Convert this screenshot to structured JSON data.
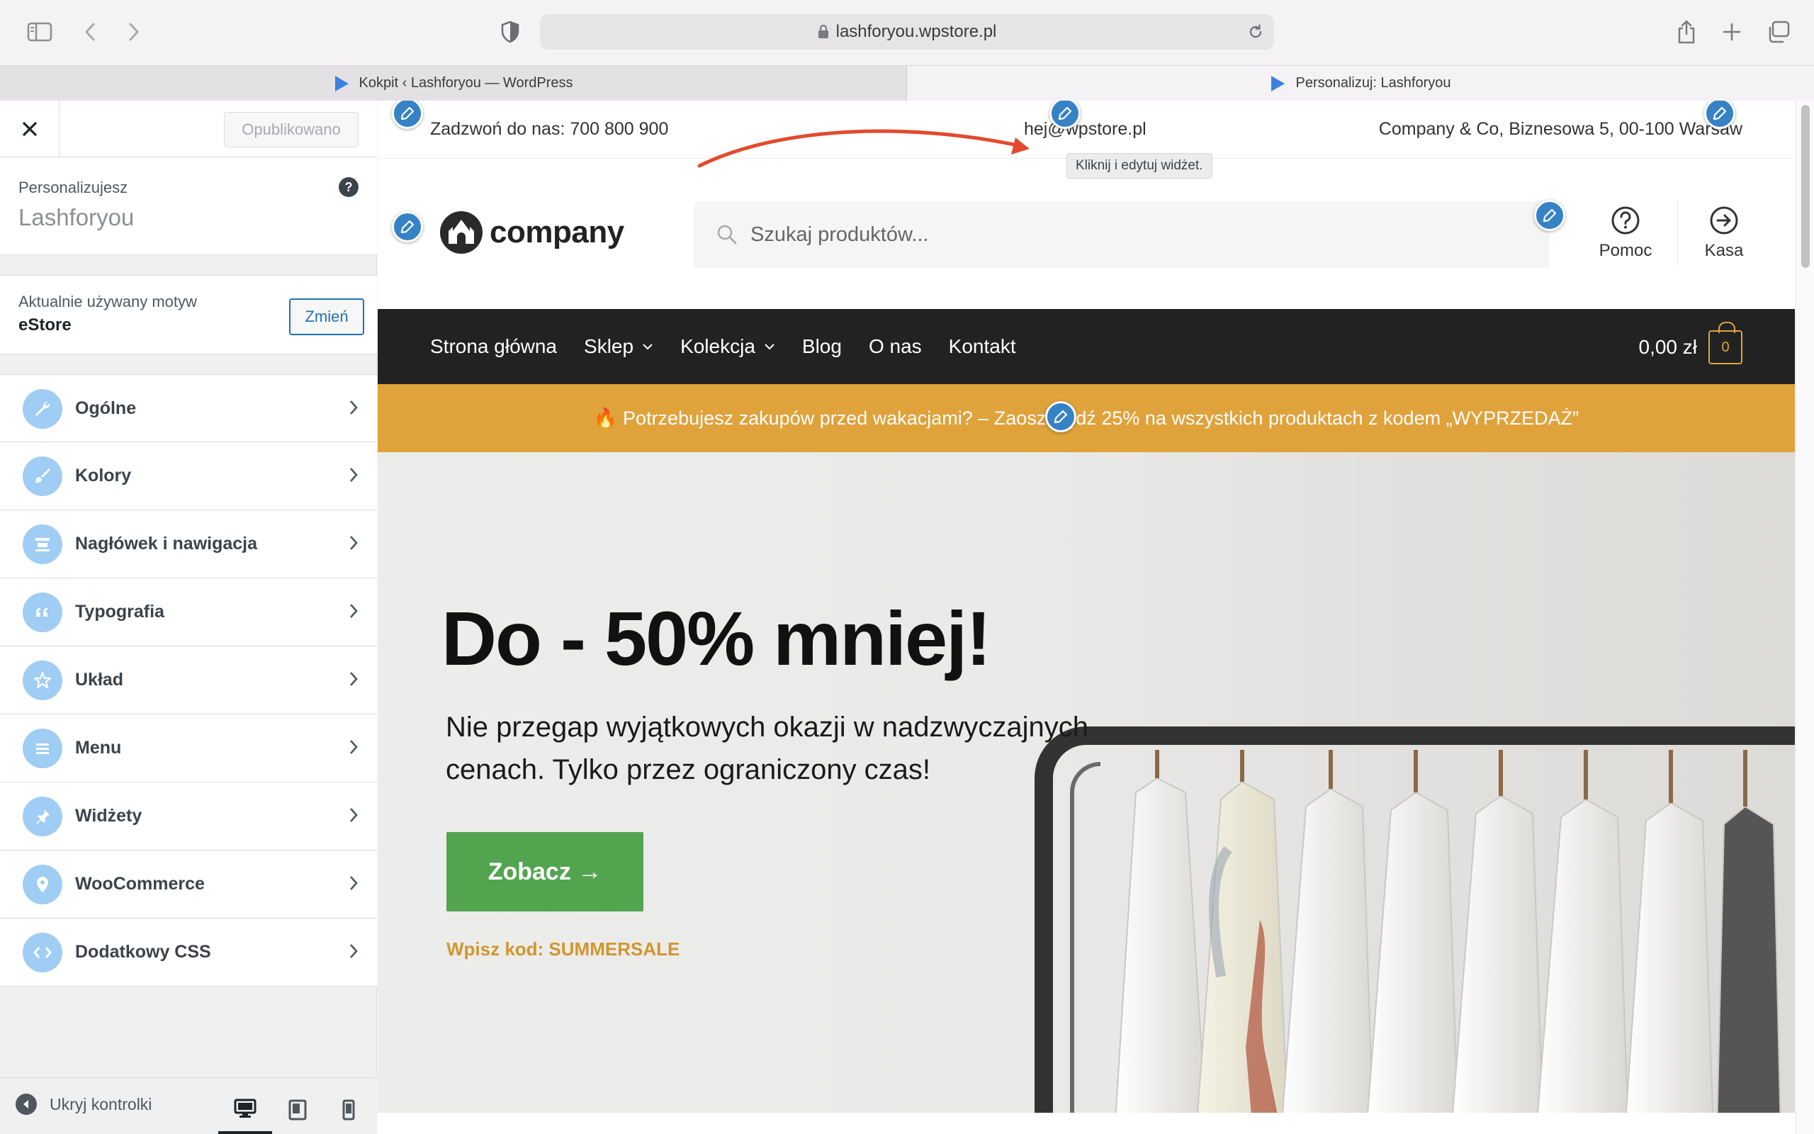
{
  "browser": {
    "url": "lashforyou.wpstore.pl",
    "tabs": [
      {
        "title": "Kokpit ‹ Lashforyou — WordPress",
        "active": false
      },
      {
        "title": "Personalizuj: Lashforyou",
        "active": true
      }
    ]
  },
  "customizer": {
    "publish_label": "Opublikowano",
    "customizing_label": "Personalizujesz",
    "site_name": "Lashforyou",
    "theme_label": "Aktualnie używany motyw",
    "theme_name": "eStore",
    "change_label": "Zmień",
    "sections": [
      {
        "label": "Ogólne",
        "icon": "wrench-icon"
      },
      {
        "label": "Kolory",
        "icon": "brush-icon"
      },
      {
        "label": "Nagłówek i nawigacja",
        "icon": "header-icon"
      },
      {
        "label": "Typografia",
        "icon": "quote-icon"
      },
      {
        "label": "Układ",
        "icon": "star-icon"
      },
      {
        "label": "Menu",
        "icon": "menu-icon"
      },
      {
        "label": "Widżety",
        "icon": "pin-icon"
      },
      {
        "label": "WooCommerce",
        "icon": "location-icon"
      },
      {
        "label": "Dodatkowy CSS",
        "icon": "code-icon"
      }
    ],
    "hide_controls_label": "Ukryj kontrolki",
    "active_device": "desktop"
  },
  "preview": {
    "topbar": {
      "phone": "Zadzwoń do nas: 700 800 900",
      "email": "hej@wpstore.pl",
      "address": "Company & Co, Biznesowa 5, 00-100 Warsaw"
    },
    "tooltip": "Kliknij i edytuj widżet.",
    "logo_text": "company",
    "search_placeholder": "Szukaj produktów...",
    "help_label": "Pomoc",
    "checkout_label": "Kasa",
    "nav": [
      {
        "label": "Strona główna",
        "dropdown": false
      },
      {
        "label": "Sklep",
        "dropdown": true
      },
      {
        "label": "Kolekcja",
        "dropdown": true
      },
      {
        "label": "Blog",
        "dropdown": false
      },
      {
        "label": "O nas",
        "dropdown": false
      },
      {
        "label": "Kontakt",
        "dropdown": false
      }
    ],
    "cart_total": "0,00 zł",
    "cart_count": "0",
    "promo": "🔥 Potrzebujesz zakupów przed wakacjami? – Zaoszczędź 25% na wszystkich produktach z kodem „WYPRZEDAŻ”",
    "hero": {
      "title": "Do - 50% mniej!",
      "subtitle": "Nie przegap wyjątkowych okazji w nadzwyczajnych cenach. Tylko przez ograniczony czas!",
      "button": "Zobacz →",
      "code": "Wpisz kod: SUMMERSALE"
    }
  },
  "colors": {
    "nav_bg": "#222222",
    "promo_bg": "#e0a23b",
    "button_green": "#52a44f",
    "accent_blue": "#2271b1",
    "edit_pencil": "#3582c4"
  }
}
